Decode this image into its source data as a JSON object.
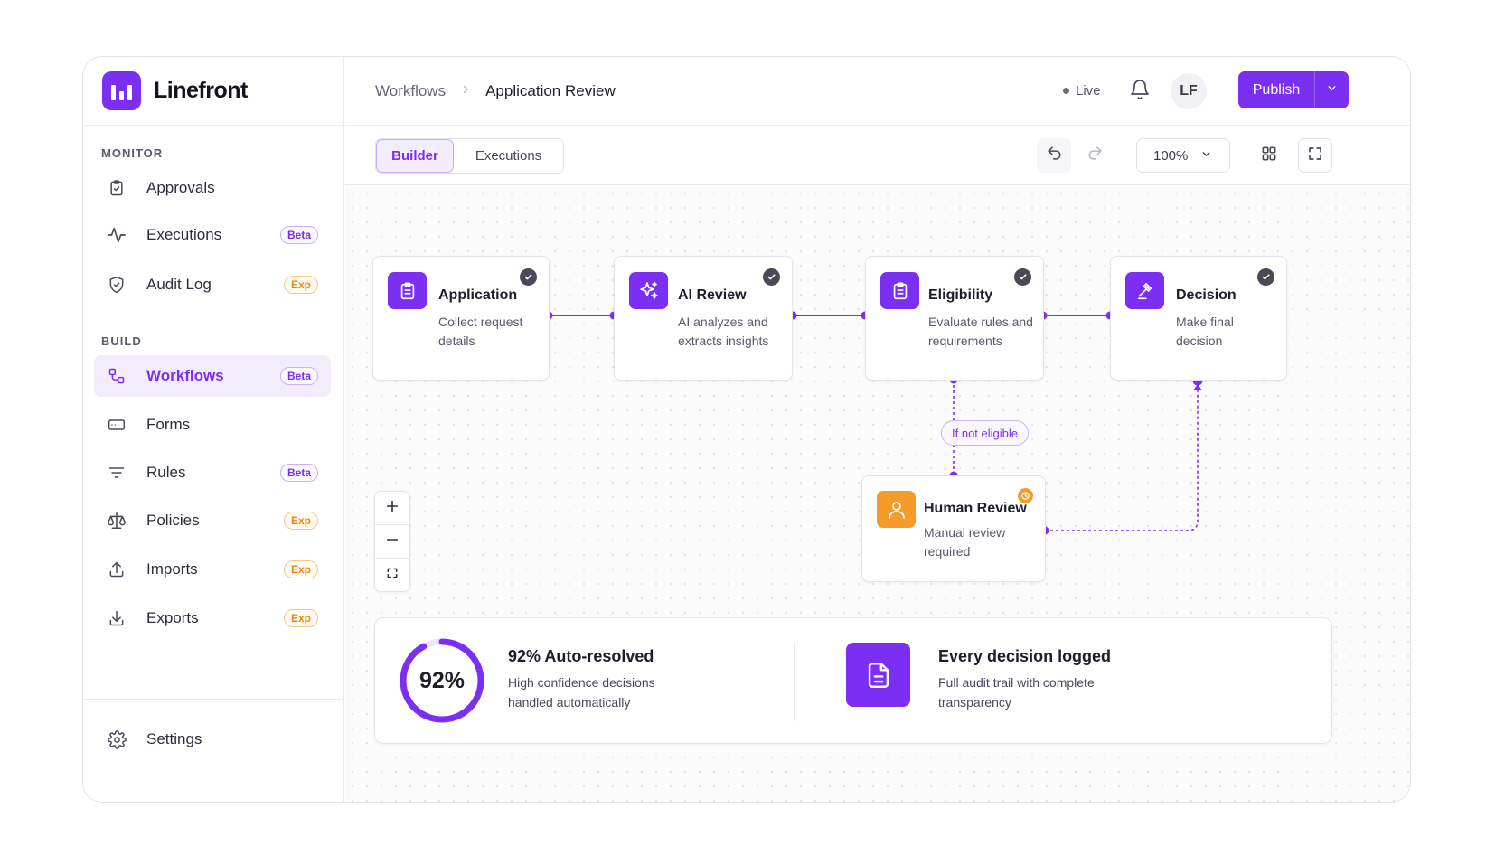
{
  "brand": {
    "name": "Linefront"
  },
  "sidebar": {
    "sections": [
      {
        "label": "MONITOR"
      },
      {
        "label": "BUILD"
      }
    ],
    "items": [
      {
        "label": "Approvals",
        "icon": "clipboard-check-icon",
        "badge": ""
      },
      {
        "label": "Executions",
        "icon": "activity-icon",
        "badge": "Beta"
      },
      {
        "label": "Audit Log",
        "icon": "shield-check-icon",
        "badge": "Exp"
      },
      {
        "label": "Workflows",
        "icon": "workflow-icon",
        "badge": "Beta",
        "active": true
      },
      {
        "label": "Forms",
        "icon": "form-icon",
        "badge": ""
      },
      {
        "label": "Rules",
        "icon": "filter-icon",
        "badge": "Beta"
      },
      {
        "label": "Policies",
        "icon": "scale-icon",
        "badge": "Exp"
      },
      {
        "label": "Imports",
        "icon": "upload-icon",
        "badge": "Exp"
      },
      {
        "label": "Exports",
        "icon": "download-icon",
        "badge": "Exp"
      }
    ],
    "settings_label": "Settings"
  },
  "header": {
    "breadcrumb": {
      "parent": "Workflows",
      "current": "Application Review"
    },
    "status": "Live",
    "avatar_initials": "LF",
    "publish_label": "Publish"
  },
  "toolbar": {
    "tabs": [
      {
        "label": "Builder",
        "active": true
      },
      {
        "label": "Executions",
        "active": false
      }
    ],
    "zoom_level": "100%"
  },
  "workflow": {
    "nodes": [
      {
        "title": "Application",
        "description": "Collect request details",
        "icon": "clipboard-icon",
        "status": "complete"
      },
      {
        "title": "AI Review",
        "description": "AI analyzes and extracts insights",
        "icon": "sparkles-icon",
        "status": "complete"
      },
      {
        "title": "Eligibility",
        "description": "Evaluate rules and requirements",
        "icon": "clipboard-icon",
        "status": "complete"
      },
      {
        "title": "Decision",
        "description": "Make final decision",
        "icon": "gavel-icon",
        "status": "complete"
      },
      {
        "title": "Human Review",
        "description": "Manual review required",
        "icon": "user-icon",
        "status": "pending"
      }
    ],
    "branch_label": "If not eligible"
  },
  "stats": {
    "auto_resolved": {
      "value_text": "92%",
      "value": 0.92,
      "title": "92% Auto-resolved",
      "description": "High confidence decisions handled automatically"
    },
    "logged": {
      "title": "Every decision logged",
      "description": "Full audit trail with complete transparency"
    }
  },
  "colors": {
    "accent": "#7b2ff2",
    "warning": "#f39c2a",
    "text": "#1f1d2b"
  }
}
